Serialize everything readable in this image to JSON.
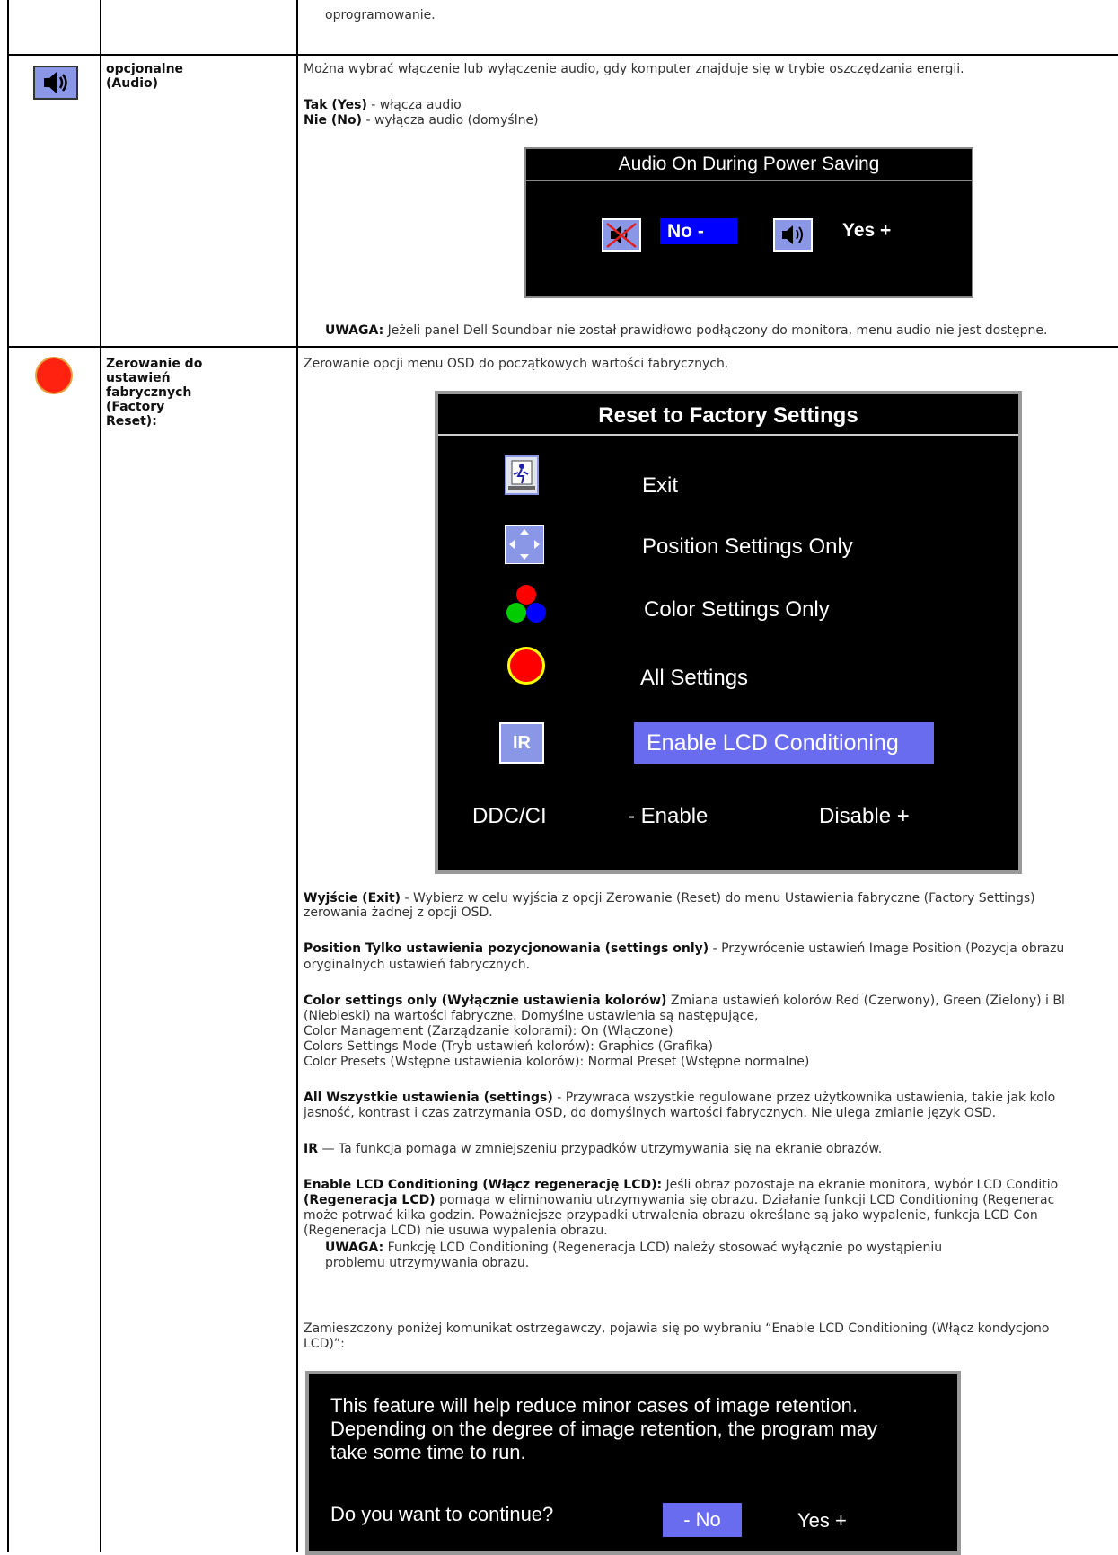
{
  "top": {
    "text": "oprogramowanie."
  },
  "audio": {
    "label_line1": "opcjonalne",
    "label_line2": "(Audio)",
    "intro": "Można wybrać włączenie lub wyłączenie audio, gdy komputer znajduje się w trybie oszczędzania energii.",
    "yes_b": "Tak (Yes)",
    "yes_t": " - włącza audio",
    "no_b": "Nie (No)",
    "no_t": " - wyłącza audio (domyślne)",
    "osd_title": "Audio On During Power Saving",
    "osd_no": "No -",
    "osd_yes": "Yes +",
    "note_b": "UWAGA:",
    "note_t": " Jeżeli panel Dell Soundbar nie został prawidłowo podłączony do monitora, menu audio nie jest dostępne."
  },
  "reset": {
    "label": [
      "Zerowanie do",
      "ustawień",
      "fabrycznych",
      "(Factory",
      "Reset):"
    ],
    "intro": "Zerowanie opcji menu OSD do początkowych wartości fabrycznych.",
    "osd_title": "Reset to Factory Settings",
    "osd_exit": "Exit",
    "osd_position": "Position Settings Only",
    "osd_color": "Color Settings Only",
    "osd_all": "All Settings",
    "osd_ir": "IR",
    "osd_lcd": "Enable LCD Conditioning",
    "osd_ddc": "DDC/CI",
    "osd_enable": "- Enable",
    "osd_disable": "Disable +",
    "exit_b": "Wyjście (Exit)",
    "exit_t1": "  - Wybierz w celu wyjścia z opcji Zerowanie (Reset) do menu Ustawienia fabryczne (Factory Settings)",
    "exit_t2": "zerowania żadnej z opcji OSD.",
    "pos_b": "Position Tylko ustawienia pozycjonowania (settings only)",
    "pos_t1": " - Przywrócenie ustawień Image Position (Pozycja obrazu",
    "pos_t2": "oryginalnych ustawień fabrycznych.",
    "col_b": "Color settings only (Wyłącznie ustawienia kolorów)",
    "col_t1": " Zmiana ustawień kolorów Red (Czerwony), Green (Zielony) i Bl",
    "col_t2": "(Niebieski) na wartości fabryczne. Domyślne ustawienia są następujące,",
    "col_t3": "Color Management (Zarządzanie kolorami): On (Włączone)",
    "col_t4": "Colors Settings Mode (Tryb ustawień kolorów): Graphics (Grafika)",
    "col_t5": "Color Presets (Wstępne ustawienia kolorów): Normal Preset (Wstępne normalne)",
    "all_b": "All Wszystkie ustawienia (settings)",
    "all_t1": " - Przywraca wszystkie regulowane przez użytkownika ustawienia, takie jak kolo",
    "all_t2": "jasność, kontrast i czas zatrzymania OSD, do domyślnych wartości fabrycznych. Nie ulega zmianie język OSD.",
    "ir_b": "IR",
    "ir_t": " —  Ta funkcja pomaga w zmniejszeniu przypadków utrzymywania się na ekranie obrazów.",
    "lcd_b": "Enable LCD Conditioning (Włącz regenerację LCD):",
    "lcd_t1": " Jeśli obraz pozostaje na ekranie monitora, wybór LCD Conditio",
    "lcd_t2b": "(Regeneracja LCD)",
    "lcd_t2": " pomaga w eliminowaniu utrzymywania się obrazu. Działanie funkcji LCD Conditioning (Regenerac",
    "lcd_t3": "może potrwać kilka godzin. Poważniejsze przypadki utrwalenia obrazu określane są jako wypalenie, funkcja LCD Con",
    "lcd_t4": "(Regeneracja LCD) nie usuwa wypalenia obrazu.",
    "note_b": "UWAGA:",
    "note_t1": " Funkcję LCD Conditioning (Regeneracja LCD) należy stosować wyłącznie po wystąpieniu",
    "note_t2": "problemu utrzymywania obrazu.",
    "warn_t1": "Zamieszczony poniżej komunikat ostrzegawczy, pojawia się po wybraniu “Enable LCD Conditioning (Włącz kondycjono",
    "warn_t2": "LCD)”:",
    "msg_l1": "This feature will help reduce minor cases of image retention.",
    "msg_l2": "Depending on the degree of image retention, the program may",
    "msg_l3": "take some time to run.",
    "msg_q": "Do you want to continue?",
    "msg_no": "- No",
    "msg_yes": "Yes +"
  }
}
